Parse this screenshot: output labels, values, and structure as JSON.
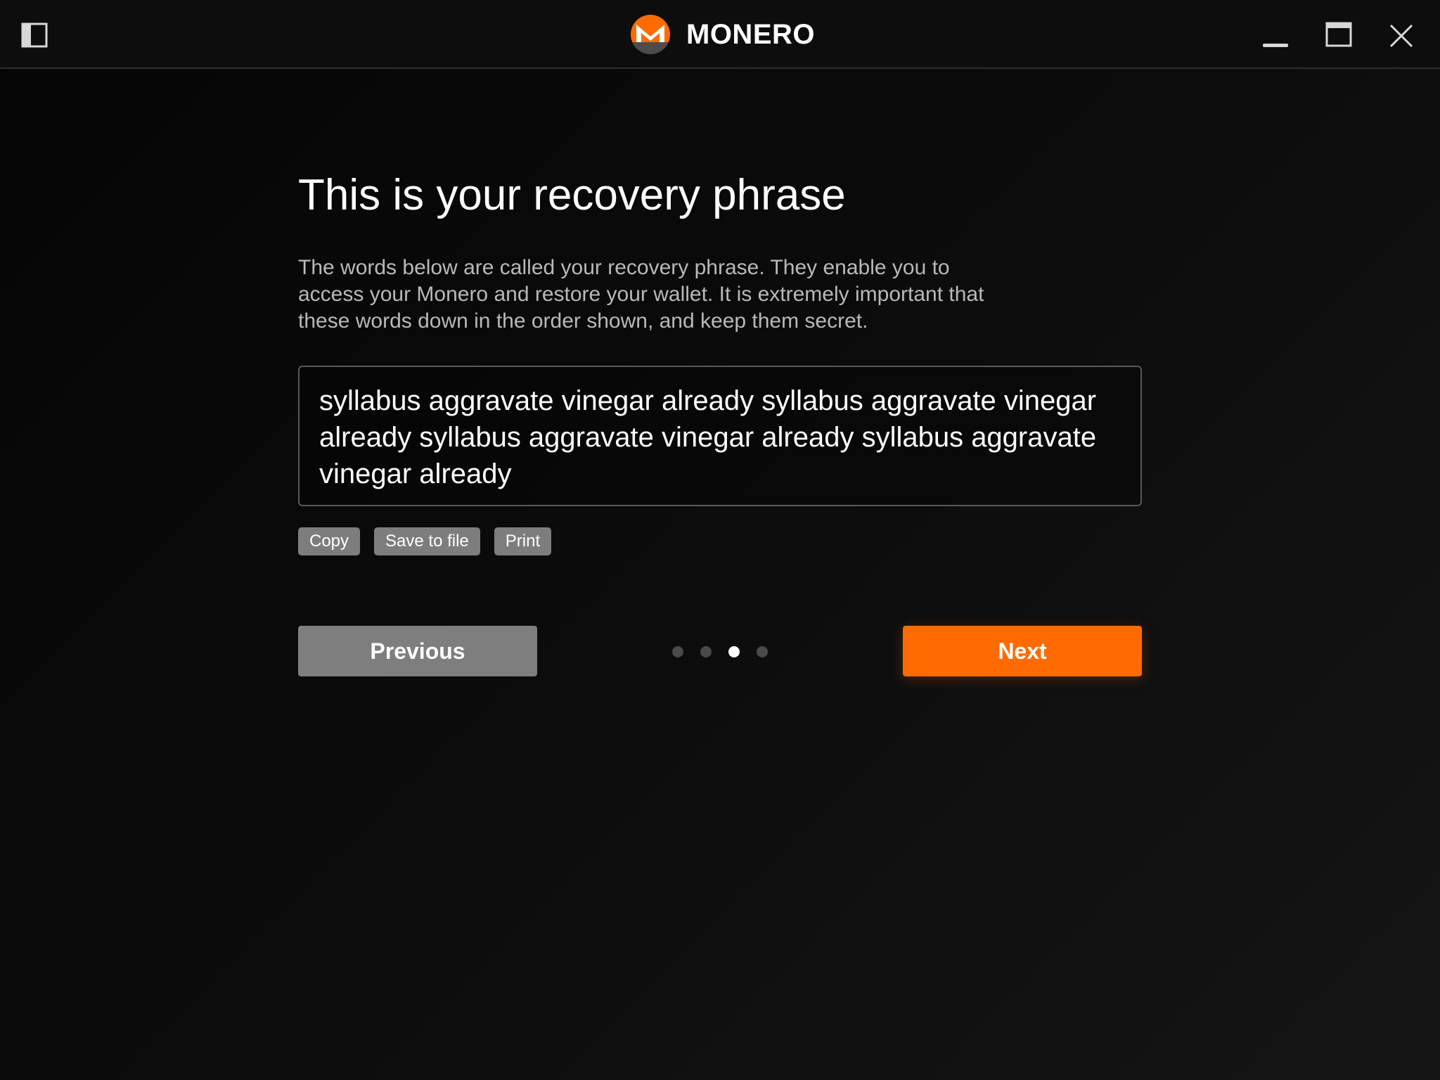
{
  "titlebar": {
    "brand_name": "MONERO",
    "icons": {
      "sidebar_toggle": "sidebar-toggle-icon",
      "logo": "monero-logo",
      "minimize": "minimize-icon",
      "maximize": "maximize-icon",
      "close": "close-icon"
    }
  },
  "main": {
    "title": "This is your recovery phrase",
    "description": "The words below are called your recovery phrase. They enable you to access your Monero and restore your wallet. It is extremely important that these words down in the order shown, and keep them secret.",
    "recovery_phrase": "syllabus aggravate vinegar already syllabus aggravate vinegar already syllabus aggravate vinegar already syllabus aggravate vinegar already",
    "actions": {
      "copy": "Copy",
      "save_to_file": "Save to file",
      "print": "Print"
    },
    "navigation": {
      "previous": "Previous",
      "next": "Next"
    },
    "progress": {
      "total_steps": 4,
      "current_step": 3
    }
  },
  "colors": {
    "accent": "#ff6b00",
    "secondary_button": "#7e7e7e",
    "background": "#0a0a0a"
  }
}
